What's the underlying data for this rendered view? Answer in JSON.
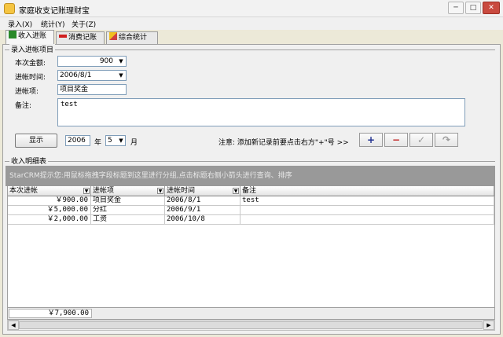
{
  "window": {
    "title": "家庭收支记账理财宝",
    "min": "─",
    "max": "□",
    "close": "✕"
  },
  "menu": [
    "录入(X)",
    "统计(Y)",
    "关于(Z)"
  ],
  "tabs": [
    "收入进账",
    "消费记账",
    "综合统计"
  ],
  "entry": {
    "group_title": "录入进帐项目",
    "amount_label": "本次金额:",
    "amount_value": "900",
    "time_label": "进帐时间:",
    "time_value": "2006/8/1",
    "item_label": "进帐项:",
    "item_value": "项目奖金",
    "note_label": "备注:",
    "note_value": "test"
  },
  "filter": {
    "show_button": "显示",
    "year_value": "2006",
    "year_unit": "年",
    "month_value": "5",
    "month_unit": "月",
    "notice": "注意: 添加新记录前要点击右方\"+\"号 >>"
  },
  "nav_buttons": {
    "add": "+",
    "delete": "−",
    "confirm": "✓",
    "cancel": "↷"
  },
  "details": {
    "group_title": "收入明细表",
    "grid_hint": "StarCRM提示您:用鼠标拖拽字段标题到这里进行分组,点击标题右侧小箭头进行查询、排序",
    "columns": [
      "本次进帐",
      "进帐项",
      "进帐时间",
      "备注"
    ],
    "rows": [
      [
        "￥900.00",
        "项目奖金",
        "2006/8/1",
        "test"
      ],
      [
        "￥5,000.00",
        "分红",
        "2006/9/1",
        ""
      ],
      [
        "￥2,000.00",
        "工资",
        "2006/10/8",
        ""
      ]
    ],
    "total": "￥7,900.00"
  },
  "colors": {
    "grid_hint_bg": "#999999",
    "add_icon": "#2a8a2a",
    "delete_icon": "#c02020"
  },
  "icons": [
    "app-icon",
    "income-tab-icon",
    "expense-tab-icon",
    "stats-tab-icon",
    "dropdown-arrow-icon",
    "scroll-left-icon",
    "scroll-right-icon"
  ]
}
